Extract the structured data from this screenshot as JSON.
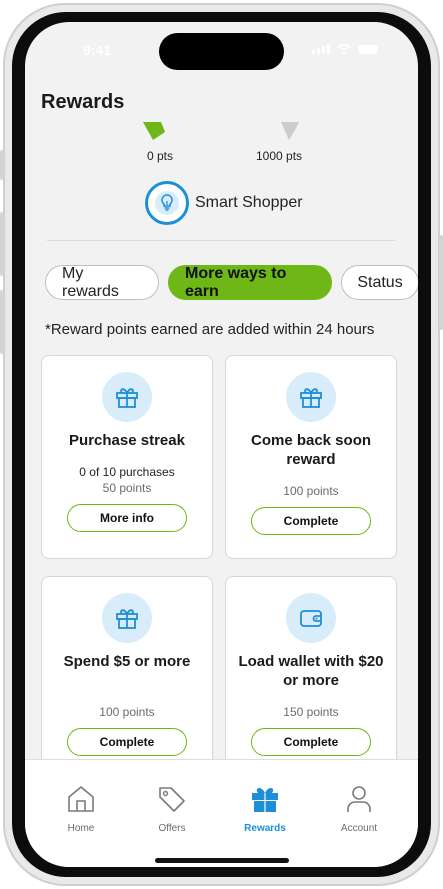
{
  "status_bar": {
    "time": "9:41"
  },
  "header": {
    "title": "Rewards"
  },
  "progress": {
    "start_label": "0 pts",
    "end_label": "1000 pts",
    "start_color": "#6fb716",
    "end_color": "#cccccc"
  },
  "tier": {
    "name": "Smart Shopper",
    "icon": "lightbulb-icon",
    "accent": "#1d8ed8"
  },
  "tabs": [
    {
      "label": "My rewards",
      "active": false
    },
    {
      "label": "More ways to earn",
      "active": true
    },
    {
      "label": "Status",
      "active": false
    }
  ],
  "note": "*Reward points earned are added within 24 hours",
  "cards": [
    {
      "icon": "gift-icon",
      "title": "Purchase streak",
      "subtitle": "0 of 10 purchases",
      "points": "50 points",
      "button": "More info"
    },
    {
      "icon": "gift-icon",
      "title": "Come back soon reward",
      "subtitle": "",
      "points": "100 points",
      "button": "Complete"
    },
    {
      "icon": "gift-icon",
      "title": "Spend $5 or more",
      "subtitle": "",
      "points": "100 points",
      "button": "Complete"
    },
    {
      "icon": "wallet-icon",
      "title": "Load wallet with $20 or more",
      "subtitle": "",
      "points": "150 points",
      "button": "Complete"
    }
  ],
  "nav": [
    {
      "label": "Home",
      "icon": "home-icon",
      "active": false
    },
    {
      "label": "Offers",
      "icon": "tag-icon",
      "active": false
    },
    {
      "label": "Rewards",
      "icon": "gift-icon",
      "active": true
    },
    {
      "label": "Account",
      "icon": "person-icon",
      "active": false
    }
  ],
  "colors": {
    "accent_green": "#6fb716",
    "accent_blue": "#1d8ed8",
    "icon_bg": "#d8edf9"
  }
}
